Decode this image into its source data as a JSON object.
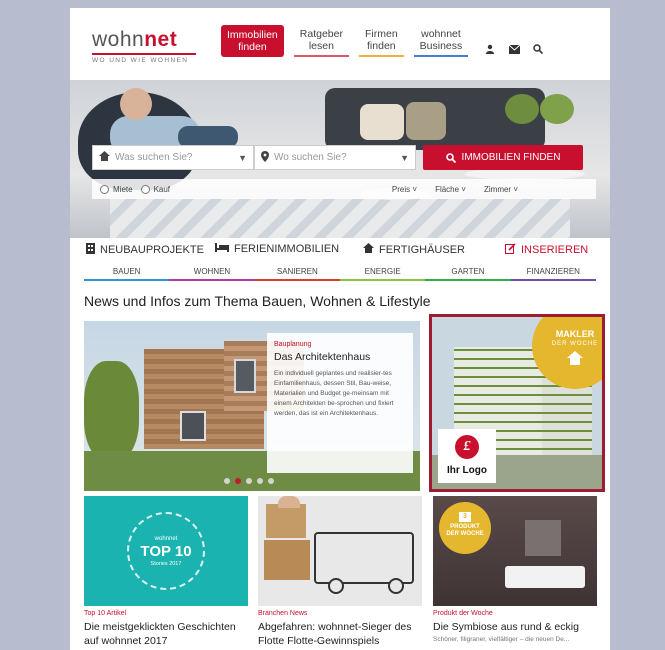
{
  "header": {
    "logo": {
      "wohn": "wohn",
      "net": "net",
      "tagline": "WO UND WIE WOHNEN"
    },
    "nav": [
      {
        "line1": "Immobilien",
        "line2": "finden"
      },
      {
        "line1": "Ratgeber",
        "line2": "lesen"
      },
      {
        "line1": "Firmen",
        "line2": "finden"
      },
      {
        "line1": "wohnnet",
        "line2": "Business"
      }
    ],
    "icons": [
      "user-icon",
      "mail-icon",
      "search-icon"
    ]
  },
  "search": {
    "what_placeholder": "Was suchen Sie?",
    "where_placeholder": "Wo suchen Sie?",
    "button_label": "IMMOBILIEN FINDEN",
    "radio_rent": "Miete",
    "radio_buy": "Kauf",
    "filter_price": "Preis",
    "filter_area": "Fläche",
    "filter_rooms": "Zimmer"
  },
  "categories": {
    "neubau": "NEUBAUPROJEKTE",
    "ferien": "FERIENIMMOBILIEN",
    "fertig": "FERTIGHÄUSER",
    "insert": "INSERIEREN"
  },
  "subnav": [
    {
      "label": "BAUEN",
      "color": "#2c9ad8"
    },
    {
      "label": "WOHNEN",
      "color": "#b03aa9"
    },
    {
      "label": "SANIEREN",
      "color": "#d8402a"
    },
    {
      "label": "ENERGIE",
      "color": "#8cc63f"
    },
    {
      "label": "GARTEN",
      "color": "#2fae4e"
    },
    {
      "label": "FINANZIEREN",
      "color": "#6b4fa8"
    }
  ],
  "section_title": "News und Infos zum Thema Bauen, Wohnen & Lifestyle",
  "feature": {
    "category": "Bauplanung",
    "title": "Das Architektenhaus",
    "text": "Ein individuell geplantes und realisier-tes Einfamilienhaus, dessen Stil, Bau-weise, Materialien und Budget ge-meinsam mit einem Architekten be-sprochen und fixiert werden, das ist ein Architektenhaus."
  },
  "ad": {
    "badge_title": "MAKLER",
    "badge_sub": "DER WOCHE",
    "logo_letter": "£",
    "logo_label": "Ihr Logo"
  },
  "cards": [
    {
      "category": "Top 10 Artikel",
      "title": "Die meistgeklickten Geschichten auf wohnnet 2017",
      "badge_small": "wohnnet",
      "badge_big": "TOP 10",
      "badge_year": "Stories 2017"
    },
    {
      "category": "Branchen News",
      "title": "Abgefahren: wohnnet-Sieger des Flotte Flotte-Gewinnspiels"
    },
    {
      "category": "Produkt der Woche",
      "title": "Die Symbiose aus rund & eckig",
      "subtitle": "Schöner, filigraner, vielfältiger – die neuen De...",
      "badge_num": "3",
      "badge_title": "PRODUKT",
      "badge_sub": "DER WOCHE"
    }
  ],
  "colors": {
    "brand": "#c8102e",
    "ad_border": "#9e1b32",
    "badge": "#e5b72e"
  }
}
